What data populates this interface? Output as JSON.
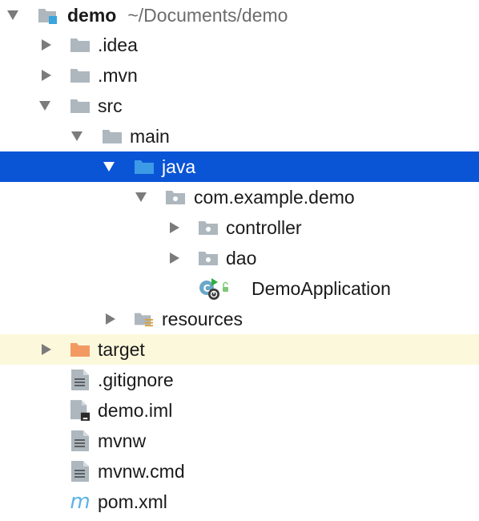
{
  "project": {
    "name": "demo",
    "path": "~/Documents/demo"
  },
  "tree": {
    "idea": ".idea",
    "mvn": ".mvn",
    "src": "src",
    "main": "main",
    "java": "java",
    "package": "com.example.demo",
    "controller": "controller",
    "dao": "dao",
    "app_class": "DemoApplication",
    "resources": "resources",
    "target": "target",
    "gitignore": ".gitignore",
    "iml": "demo.iml",
    "mvnw": "mvnw",
    "mvnw_cmd": "mvnw.cmd",
    "pom": "pom.xml"
  },
  "icons": {
    "project": "module-folder-icon",
    "folder": "folder-icon",
    "source_root": "source-root-folder-icon",
    "package": "package-icon",
    "resources": "resources-root-icon",
    "excluded": "excluded-folder-icon",
    "text_file": "text-file-icon",
    "iml_file": "module-file-icon",
    "spring_boot_class": "spring-boot-class-icon",
    "maven": "maven-icon"
  },
  "colors": {
    "selection": "#0a54d6",
    "excluded_row": "#fcf8dc",
    "folder": "#aeb7be",
    "source_root": "#3d9ae6",
    "excluded_folder": "#f39a63",
    "module_accent": "#3aa4dc",
    "path_text": "#6c6c6c"
  }
}
